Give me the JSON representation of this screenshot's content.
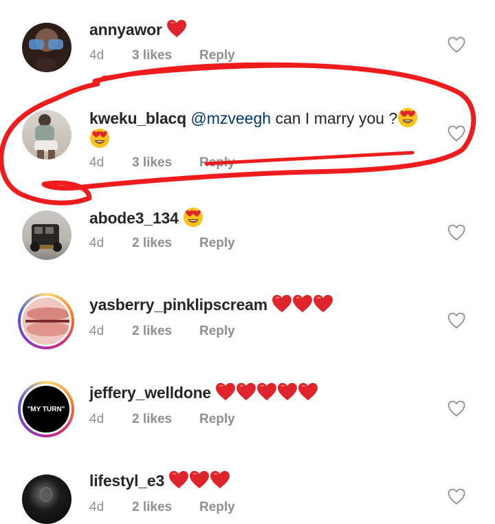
{
  "colors": {
    "username": "#262626",
    "meta": "#8e8e8e",
    "mention": "#00376b",
    "heart_emoji": "#e0242b",
    "annotation": "#ee1c1c"
  },
  "comments": [
    {
      "username": "annyawor",
      "mention": "",
      "text": "",
      "emojis": [
        "red-heart"
      ],
      "time": "4d",
      "likes": "3 likes",
      "reply": "Reply"
    },
    {
      "username": "kweku_blacq",
      "mention": "@mzveegh",
      "text": "can I marry you ?",
      "emojis": [
        "heart-eyes-face",
        "heart-eyes-face"
      ],
      "time": "4d",
      "likes": "3 likes",
      "reply": "Reply"
    },
    {
      "username": "abode3_134",
      "mention": "",
      "text": "",
      "emojis": [
        "heart-eyes-face"
      ],
      "time": "4d",
      "likes": "2 likes",
      "reply": "Reply"
    },
    {
      "username": "yasberry_pinklipscream",
      "mention": "",
      "text": "",
      "emojis": [
        "red-heart",
        "red-heart",
        "red-heart"
      ],
      "time": "4d",
      "likes": "2 likes",
      "reply": "Reply"
    },
    {
      "username": "jeffery_welldone",
      "mention": "",
      "text": "",
      "emojis": [
        "red-heart",
        "red-heart",
        "red-heart",
        "red-heart",
        "red-heart"
      ],
      "time": "4d",
      "likes": "2 likes",
      "reply": "Reply",
      "avatar_text": "\"MY TURN\""
    },
    {
      "username": "lifestyl_e3",
      "mention": "",
      "text": "",
      "emojis": [
        "red-heart",
        "red-heart",
        "red-heart"
      ],
      "time": "4d",
      "likes": "2 likes",
      "reply": "Reply"
    }
  ]
}
